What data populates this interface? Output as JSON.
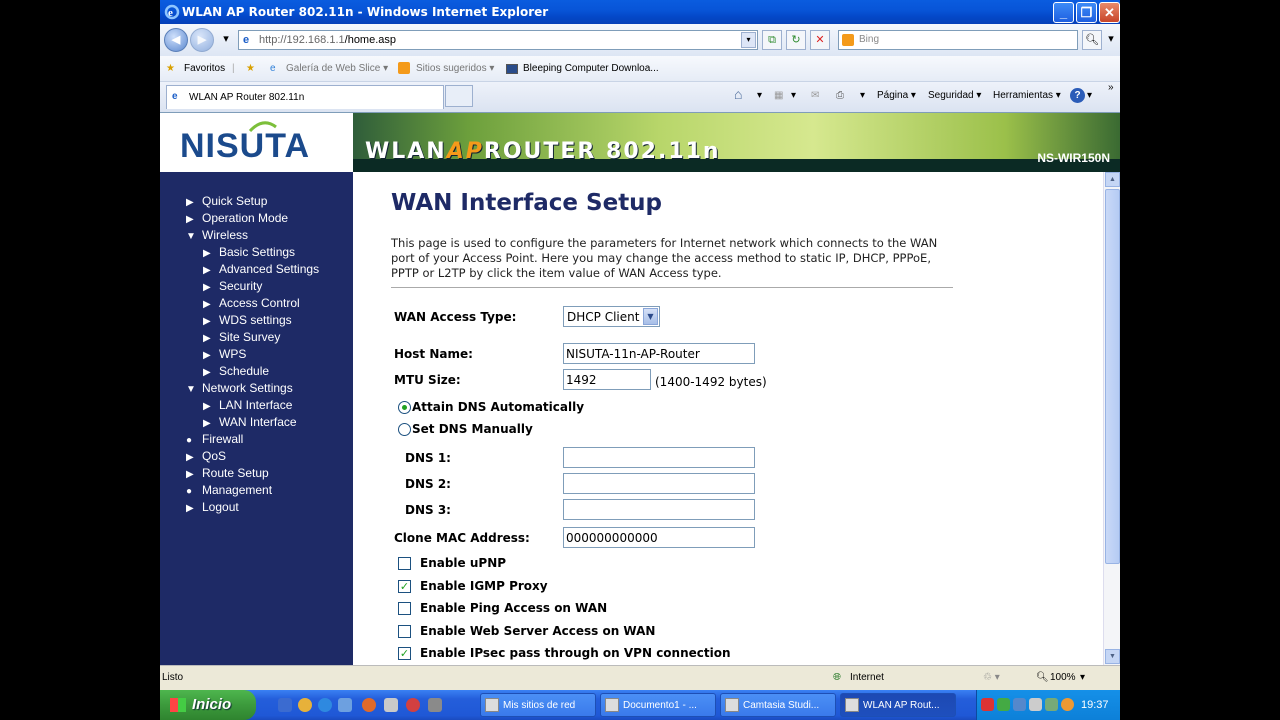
{
  "window": {
    "title": "WLAN AP Router 802.11n - Windows Internet Explorer"
  },
  "address_bar": {
    "url_host": "http://192.168.1.1",
    "url_path": "/home.asp",
    "search_placeholder": "Bing"
  },
  "favorites_bar": {
    "favorites_label": "Favoritos",
    "items": [
      "Galería de Web Slice ▾",
      "Sitios sugeridos ▾",
      "Bleeping Computer Downloa..."
    ]
  },
  "tabs": {
    "active_tab": "WLAN AP Router 802.11n"
  },
  "command_bar": {
    "pagina": "Página ▾",
    "seguridad": "Seguridad ▾",
    "herramientas": "Herramientas ▾"
  },
  "banner": {
    "logo": "NISUTA",
    "title_prefix": "WLAN",
    "title_ap": "AP",
    "title_suffix": "ROUTER 802.11n",
    "model": "NS-WIR150N"
  },
  "sidebar": {
    "items": [
      {
        "label": "Quick Setup",
        "marker": "▶"
      },
      {
        "label": "Operation Mode",
        "marker": "▶"
      },
      {
        "label": "Wireless",
        "marker": "▼"
      },
      {
        "label": "Basic Settings",
        "marker": "▶"
      },
      {
        "label": "Advanced Settings",
        "marker": "▶"
      },
      {
        "label": "Security",
        "marker": "▶"
      },
      {
        "label": "Access Control",
        "marker": "▶"
      },
      {
        "label": "WDS settings",
        "marker": "▶"
      },
      {
        "label": "Site Survey",
        "marker": "▶"
      },
      {
        "label": "WPS",
        "marker": "▶"
      },
      {
        "label": "Schedule",
        "marker": "▶"
      },
      {
        "label": "Network Settings",
        "marker": "▼"
      },
      {
        "label": "LAN Interface",
        "marker": "▶"
      },
      {
        "label": "WAN Interface",
        "marker": "▶"
      },
      {
        "label": "Firewall",
        "marker": "●"
      },
      {
        "label": "QoS",
        "marker": "▶"
      },
      {
        "label": "Route Setup",
        "marker": "▶"
      },
      {
        "label": "Management",
        "marker": "●"
      },
      {
        "label": "Logout",
        "marker": "▶"
      }
    ]
  },
  "content": {
    "title": "WAN Interface Setup",
    "description": "This page is used to configure the parameters for Internet network which connects to the WAN port of your Access Point. Here you may change the access method to static IP, DHCP, PPPoE, PPTP or L2TP by click the item value of WAN Access type.",
    "wan_access_type_label": "WAN Access Type:",
    "wan_access_type_value": "DHCP Client",
    "host_name_label": "Host Name:",
    "host_name_value": "NISUTA-11n-AP-Router",
    "mtu_label": "MTU Size:",
    "mtu_value": "1492",
    "mtu_note": "(1400-1492 bytes)",
    "attain_dns_label": "Attain DNS Automatically",
    "set_dns_label": "Set DNS Manually",
    "dns1_label": "DNS 1:",
    "dns2_label": "DNS 2:",
    "dns3_label": "DNS 3:",
    "dns1_value": "",
    "dns2_value": "",
    "dns3_value": "",
    "clone_mac_label": "Clone MAC Address:",
    "clone_mac_value": "000000000000",
    "checkboxes": [
      {
        "label": "Enable uPNP",
        "checked": false
      },
      {
        "label": "Enable IGMP Proxy",
        "checked": true
      },
      {
        "label": "Enable Ping Access on WAN",
        "checked": false
      },
      {
        "label": "Enable Web Server Access on WAN",
        "checked": false
      },
      {
        "label": "Enable IPsec pass through on VPN connection",
        "checked": true
      }
    ]
  },
  "status_bar": {
    "status": "Listo",
    "zone": "Internet",
    "zoom": "100%"
  },
  "taskbar": {
    "start": "Inicio",
    "items": [
      "Mis sitios de red",
      "Documento1 - ...",
      "Camtasia Studi...",
      "WLAN AP Rout..."
    ],
    "clock": "19:37"
  }
}
